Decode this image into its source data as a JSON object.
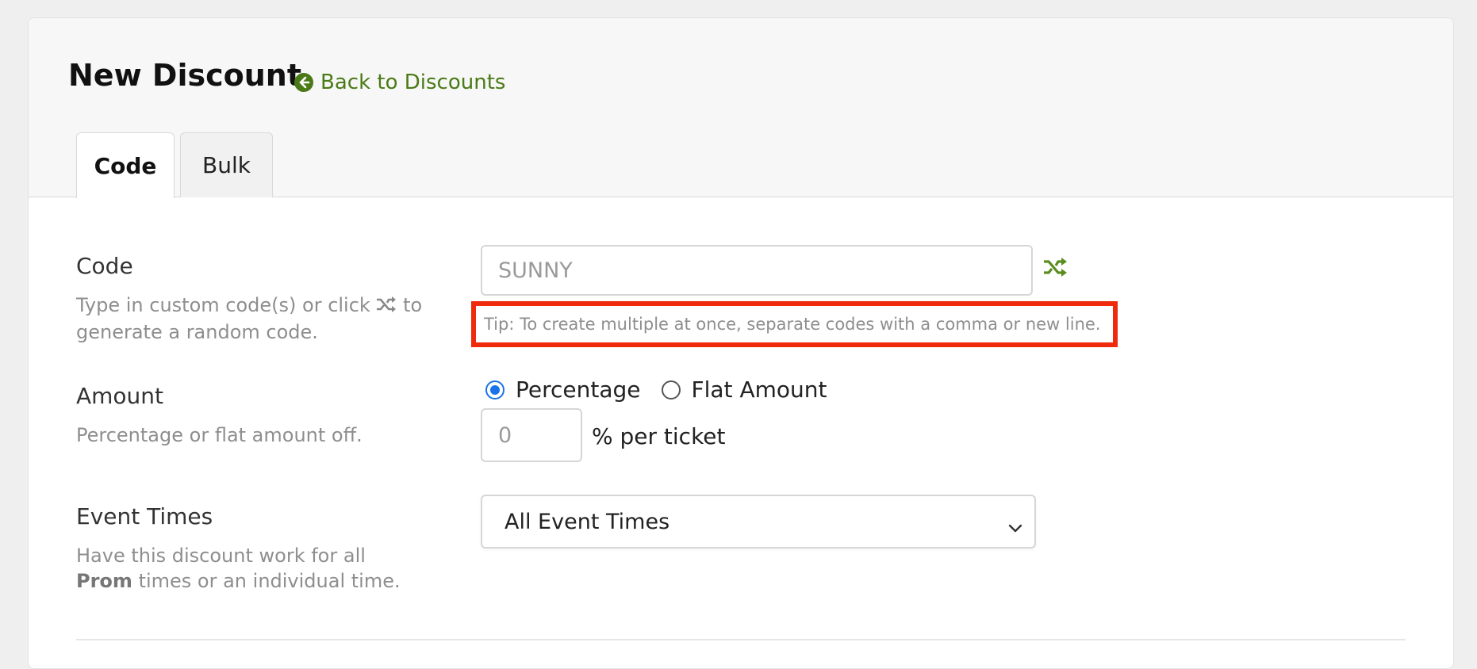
{
  "header": {
    "title": "New Discount",
    "back_link": "Back to Discounts",
    "back_icon": "arrow-circle-left-icon",
    "accent_color": "#4a7a16"
  },
  "tabs": [
    {
      "label": "Code",
      "active": true
    },
    {
      "label": "Bulk",
      "active": false
    }
  ],
  "code_section": {
    "label": "Code",
    "description_before": "Type in custom code(s) or click",
    "description_after": "to generate a random code.",
    "inline_icon": "shuffle-icon",
    "input_placeholder": "SUNNY",
    "input_value": "",
    "tip": "Tip: To create multiple at once, separate codes with a comma or new line.",
    "highlight_color": "#f02a0c"
  },
  "amount_section": {
    "label": "Amount",
    "description": "Percentage or flat amount off.",
    "options": [
      {
        "label": "Percentage",
        "selected": true
      },
      {
        "label": "Flat Amount",
        "selected": false
      }
    ],
    "input_placeholder": "0",
    "unit": "% per ticket"
  },
  "event_times_section": {
    "label": "Event Times",
    "description_before": "Have this discount work for all",
    "event_name": "Prom",
    "description_after": "times or an individual time.",
    "selected": "All Event Times"
  }
}
